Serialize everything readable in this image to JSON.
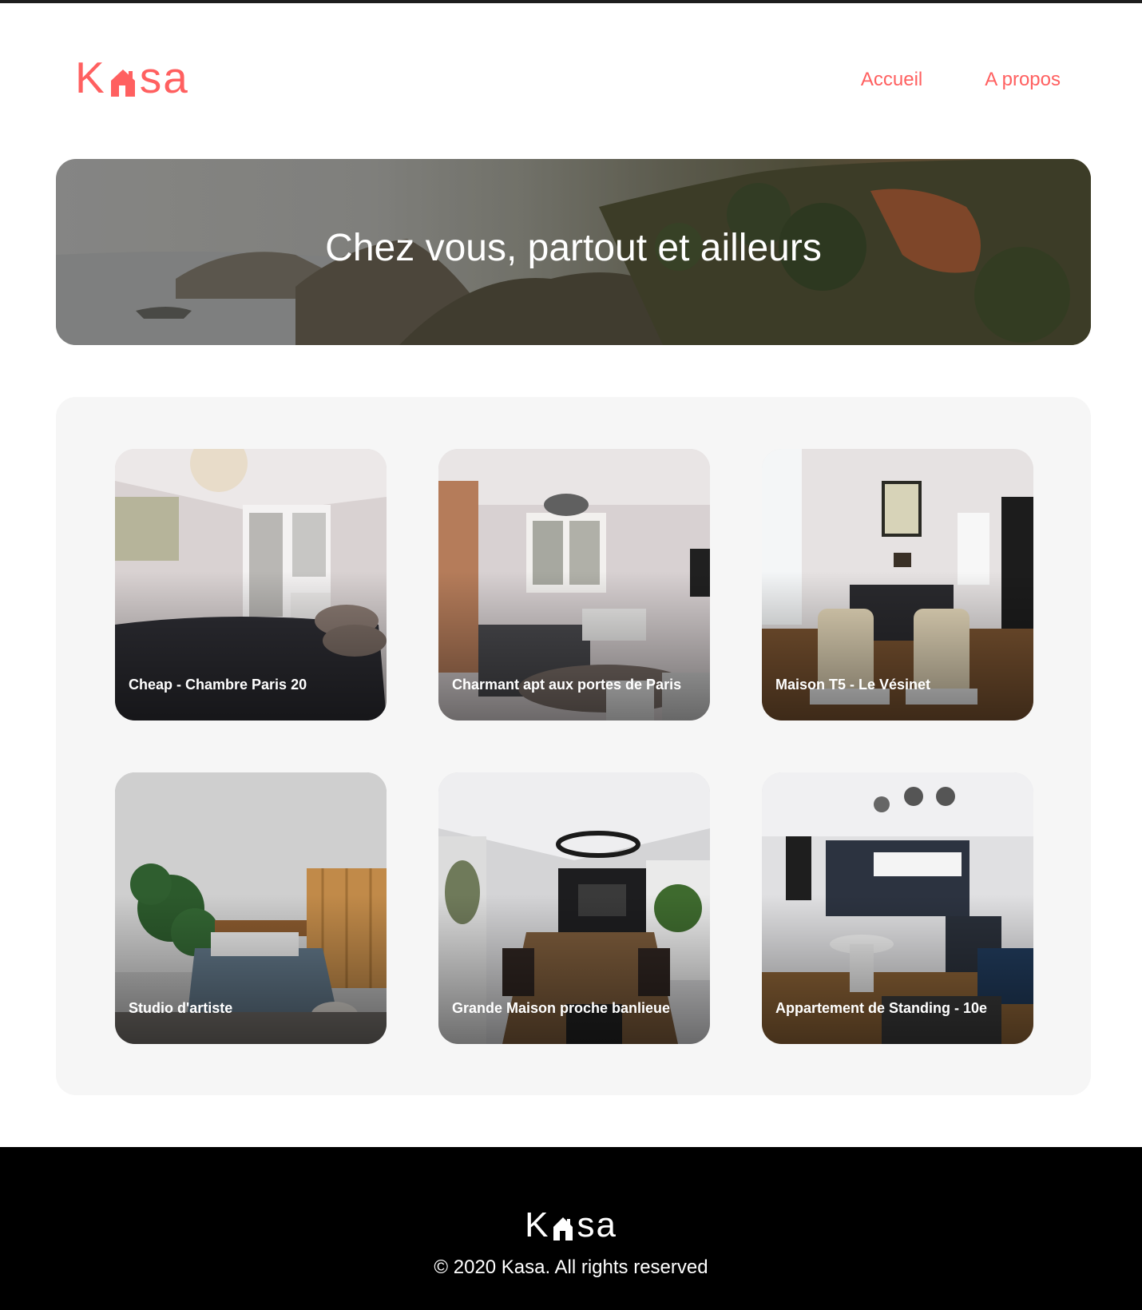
{
  "header": {
    "logo_prefix": "K",
    "logo_suffix": "sa",
    "logo_icon": "house-icon",
    "nav": [
      {
        "label": "Accueil"
      },
      {
        "label": "A propos"
      }
    ]
  },
  "banner": {
    "title": "Chez vous, partout et ailleurs"
  },
  "listings": [
    {
      "title": "Cheap - Chambre Paris 20"
    },
    {
      "title": "Charmant apt aux portes de Paris"
    },
    {
      "title": "Maison T5 - Le Vésinet"
    },
    {
      "title": "Studio d'artiste"
    },
    {
      "title": "Grande Maison proche banlieue"
    },
    {
      "title": "Appartement de Standing - 10e"
    }
  ],
  "footer": {
    "logo_prefix": "K",
    "logo_suffix": "sa",
    "copyright": "© 2020 Kasa. All rights reserved"
  },
  "colors": {
    "accent": "#FF6060",
    "gallery_bg": "#F6F6F6",
    "footer_bg": "#000000"
  }
}
